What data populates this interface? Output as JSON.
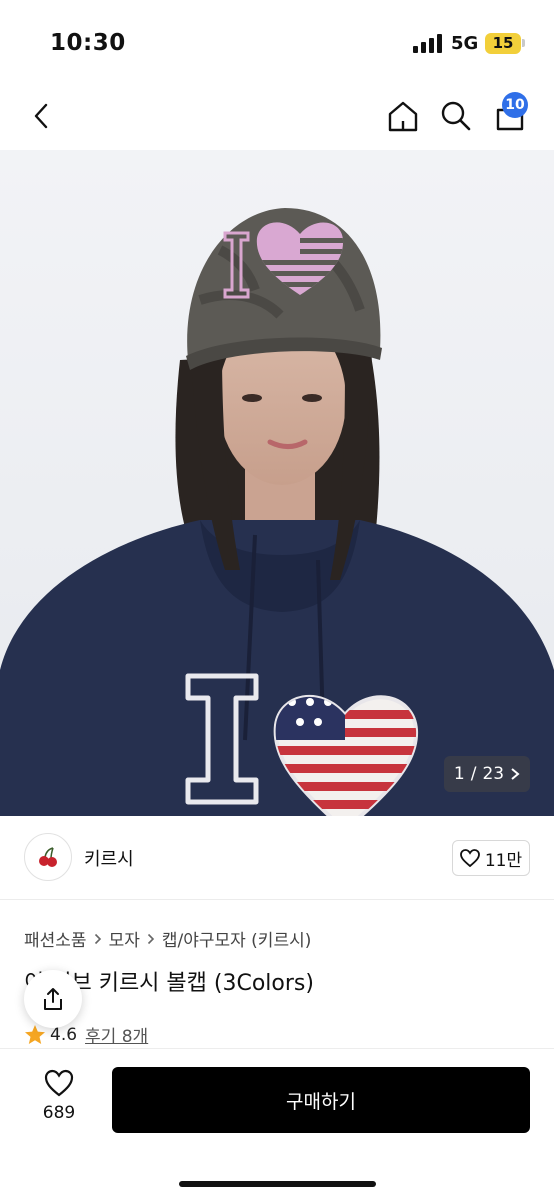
{
  "status": {
    "time": "10:30",
    "network": "5G",
    "battery": "15"
  },
  "nav": {
    "cart_count": "10"
  },
  "gallery": {
    "current": "1",
    "total": "23",
    "separator": "/"
  },
  "shop": {
    "name": "키르시",
    "like_count": "11만"
  },
  "breadcrumb": [
    "패션소품",
    "모자",
    "캡/야구모자 (키르시)"
  ],
  "product": {
    "title": "이 러브 키르시 볼캡 (3Colors)",
    "rating": "4.6",
    "reviews": "후기 8개"
  },
  "bottom": {
    "wish_count": "689",
    "buy_label": "구매하기"
  },
  "colors": {
    "cart_badge": "#2f6fe8",
    "star": "#f5a623",
    "buy": "#000000"
  }
}
